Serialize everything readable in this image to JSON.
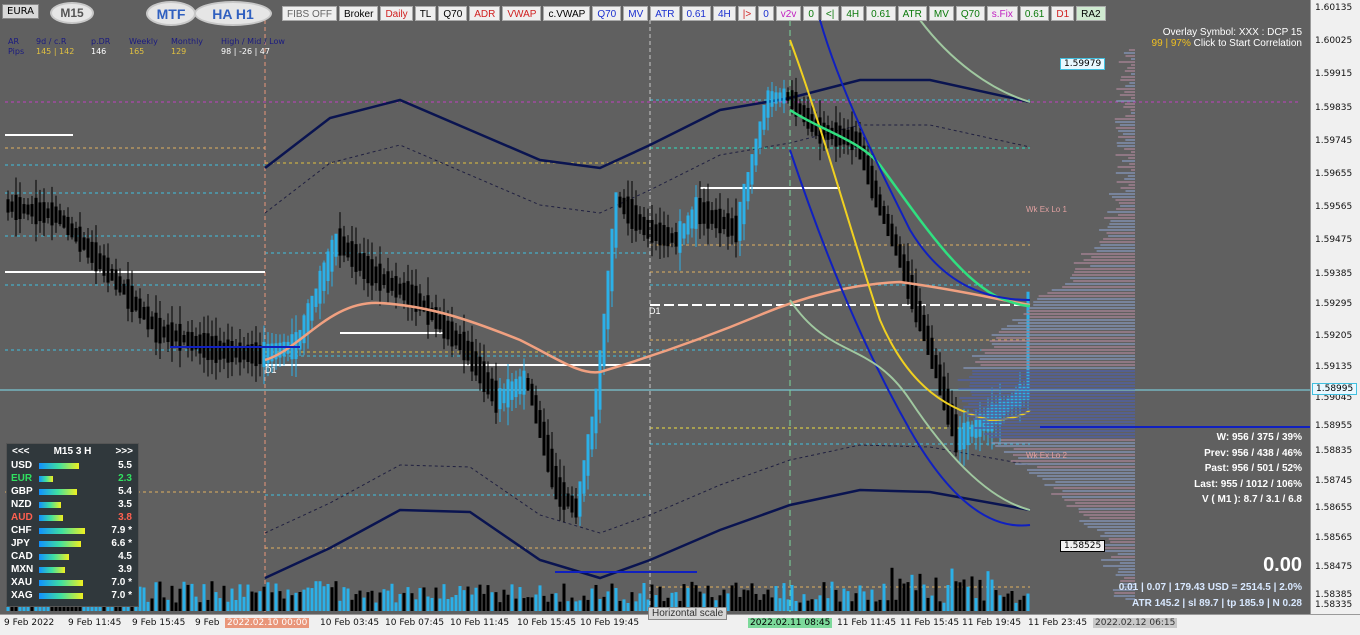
{
  "window": {
    "symbol_tab": "EURA",
    "timeframe_oval": "M15",
    "mtf_oval": "MTF",
    "ha_oval": "HA H1"
  },
  "toolbar": [
    {
      "label": "FIBS OFF",
      "style": "gray"
    },
    {
      "label": "Broker",
      "style": ""
    },
    {
      "label": "Daily",
      "style": "red"
    },
    {
      "label": "TL",
      "style": ""
    },
    {
      "label": "Q70",
      "style": ""
    },
    {
      "label": "ADR",
      "style": "red"
    },
    {
      "label": "VWAP",
      "style": "red"
    },
    {
      "label": "c.VWAP",
      "style": ""
    },
    {
      "label": "Q70",
      "style": "blue"
    },
    {
      "label": "MV",
      "style": "blue"
    },
    {
      "label": "ATR",
      "style": "blue"
    },
    {
      "label": "0.61",
      "style": "blue"
    },
    {
      "label": "4H",
      "style": "blue"
    },
    {
      "label": "|>",
      "style": "red"
    },
    {
      "label": "0",
      "style": "blue"
    },
    {
      "label": "v2v",
      "style": "magenta"
    },
    {
      "label": "0",
      "style": "green"
    },
    {
      "label": "<|",
      "style": "green"
    },
    {
      "label": "4H",
      "style": "green"
    },
    {
      "label": "0.61",
      "style": "green"
    },
    {
      "label": "ATR",
      "style": "green"
    },
    {
      "label": "MV",
      "style": "green"
    },
    {
      "label": "Q70",
      "style": "green"
    },
    {
      "label": "s.Fix",
      "style": "magenta"
    },
    {
      "label": "0.61",
      "style": "green"
    },
    {
      "label": "D1",
      "style": "red"
    },
    {
      "label": "RA2",
      "style": "ltgreen"
    }
  ],
  "stats": {
    "headers": [
      "AR",
      "9d / c.R",
      "p.DR",
      "Weekly",
      "Monthly",
      "High / Mid / Low"
    ],
    "row_label": "Pips",
    "values": [
      "145 | 142",
      "146",
      "165",
      "129",
      "98 | -26 | 47"
    ]
  },
  "currency_panel": {
    "prev": "<<<",
    "title": "M15  3  H",
    "next": ">>>",
    "rows": [
      {
        "name": "USD",
        "value": "5.5",
        "bar": 40,
        "name_color": "#ffffff"
      },
      {
        "name": "EUR",
        "value": "2.3",
        "bar": 14,
        "name_color": "#30e060"
      },
      {
        "name": "GBP",
        "value": "5.4",
        "bar": 38,
        "name_color": "#ffffff"
      },
      {
        "name": "NZD",
        "value": "3.5",
        "bar": 22,
        "name_color": "#ffffff"
      },
      {
        "name": "AUD",
        "value": "3.8",
        "bar": 24,
        "name_color": "#ff6050"
      },
      {
        "name": "CHF",
        "value": "7.9 *",
        "bar": 46,
        "name_color": "#ffffff"
      },
      {
        "name": "JPY",
        "value": "6.6 *",
        "bar": 42,
        "name_color": "#ffffff"
      },
      {
        "name": "CAD",
        "value": "4.5",
        "bar": 30,
        "name_color": "#ffffff"
      },
      {
        "name": "MXN",
        "value": "3.9",
        "bar": 26,
        "name_color": "#ffffff"
      },
      {
        "name": "XAU",
        "value": "7.0 *",
        "bar": 44,
        "name_color": "#ffffff"
      },
      {
        "name": "XAG",
        "value": "7.0 *",
        "bar": 44,
        "name_color": "#ffffff"
      }
    ]
  },
  "overlay": {
    "line1": "Overlay Symbol: XXX : DCP 15",
    "line2_prefix": "99 | 97%",
    "line2_link": " Click to Start Correlation"
  },
  "wk_info": [
    "W: 956 / 375 / 39%",
    "Prev: 956 / 438 / 46%",
    "Past: 956 / 501 / 52%",
    "Last: 955 / 1012 / 106%",
    "V ( M1 ): 8.7 / 3.1 / 6.8"
  ],
  "big_value": "0.00",
  "bottom_info": [
    "0.01  |  0.07  |  179.43 USD = 2514.5  |  2.0%",
    "ATR 145.2  |  sl 89.7  |  tp 185.9  |  N 0.28"
  ],
  "chart_labels": {
    "wk_ex_lo_1": "Wk Ex Lo 1",
    "wk_ex_lo_2": "Wk Ex Lo 2",
    "d1_a": "D1",
    "d1_b": "D1",
    "hscale": "Horizontal scale"
  },
  "price_labels": {
    "p1": "1.59979",
    "p2": "1.58995",
    "p3": "1.58525"
  },
  "price_axis": [
    "1.60135",
    "1.60025",
    "1.59915",
    "1.59835",
    "1.59745",
    "1.59655",
    "1.59565",
    "1.59475",
    "1.59385",
    "1.59295",
    "1.59205",
    "1.59135",
    "1.59045",
    "1.58955",
    "1.58835",
    "1.58745",
    "1.58655",
    "1.58565",
    "1.58475",
    "1.58385",
    "1.58335"
  ],
  "time_axis": [
    {
      "label": "9 Feb 2022",
      "style": ""
    },
    {
      "label": "9 Feb 11:45",
      "style": ""
    },
    {
      "label": "9 Feb 15:45",
      "style": ""
    },
    {
      "label": "9 Feb",
      "style": ""
    },
    {
      "label": "2022.02.10 00:00",
      "style": "hl-red"
    },
    {
      "label": "10 Feb 03:45",
      "style": ""
    },
    {
      "label": "10 Feb 07:45",
      "style": ""
    },
    {
      "label": "10 Feb 11:45",
      "style": ""
    },
    {
      "label": "10 Feb 15:45",
      "style": ""
    },
    {
      "label": "10 Feb 19:45",
      "style": ""
    },
    {
      "label": "2022.02.11 08:45",
      "style": "hl-green"
    },
    {
      "label": "11 Feb 11:45",
      "style": ""
    },
    {
      "label": "11 Feb 15:45",
      "style": ""
    },
    {
      "label": "11 Feb 19:45",
      "style": ""
    },
    {
      "label": "11 Feb 23:45",
      "style": ""
    },
    {
      "label": "2022.02.12 06:15",
      "style": "hl-gray"
    }
  ],
  "colors": {
    "bull_candle": "#2bb0e8",
    "bear_candle": "#000000",
    "vwap": "#f0a080",
    "bands": "#0a1450",
    "yellow_ma": "#f0d020",
    "green_ma": "#30e080",
    "blue_ma": "#1020c0"
  }
}
